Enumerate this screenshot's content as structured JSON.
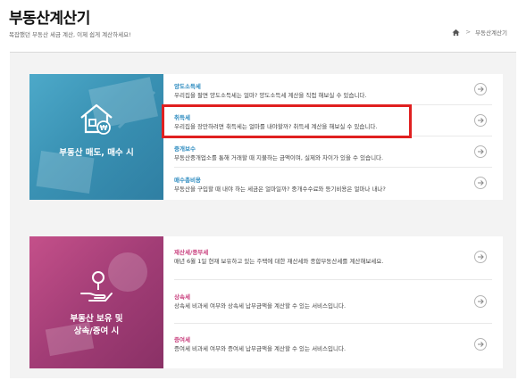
{
  "header": {
    "title": "부동산계산기",
    "subtitle": "복잡했던 부동산 세금 계산, 이제 쉽게 계산하세요!",
    "breadcrumb": {
      "separator": ">",
      "current": "부동산계산기"
    }
  },
  "section1": {
    "banner_label": "부동산 매도, 매수 시",
    "title_color": "#2f8cc0",
    "items": [
      {
        "title": "양도소득세",
        "desc": "우리집을 팔면 양도소득세는 얼마? 양도소득세 계산을 직접 해보실 수 있습니다."
      },
      {
        "title": "취득세",
        "desc": "우리집을 장만하려면 취득세는 얼마를 내야할까? 취득세 계산을 해보실 수 있습니다."
      },
      {
        "title": "중개보수",
        "desc": "부동산중개업소를 통해 거래할 때 지불하는 금액이며, 실제와 차이가 있을 수 있습니다."
      },
      {
        "title": "매수총비용",
        "desc": "부동산을 구입할 때 내야 하는 세금은 얼마일까? 중개수수료와 등기비용은 얼마나 내나?"
      }
    ]
  },
  "section2": {
    "banner_label_line1": "부동산 보유 및",
    "banner_label_line2": "상속/증여 시",
    "title_color": "#c9407e",
    "items": [
      {
        "title": "재산세/종부세",
        "desc": "매년 6월 1일 현재 보유하고 있는 주택에 대한 재산세와 종합부동산세를 계산해보세요."
      },
      {
        "title": "상속세",
        "desc": "상속세 비과세 여부와 상속세 납부금액을 계산할 수 있는 서비스입니다."
      },
      {
        "title": "증여세",
        "desc": "증여세 비과세 여부와 증여세 납부금액을 계산할 수 있는 서비스입니다."
      }
    ]
  },
  "highlight": {
    "color": "#e02020",
    "target": "취득세"
  }
}
